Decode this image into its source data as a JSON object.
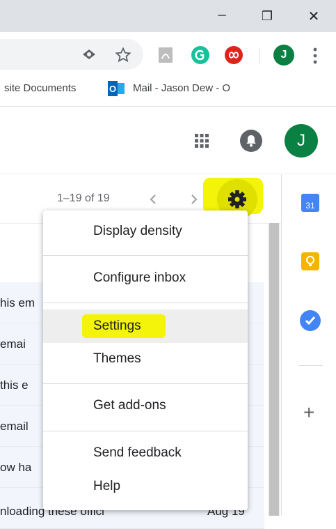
{
  "window": {
    "minimize_glyph": "─",
    "restore_glyph": "❐",
    "close_glyph": "✕"
  },
  "toolbar": {
    "avatar_letter": "J"
  },
  "bookmarks": {
    "items": [
      {
        "label": "site Documents"
      },
      {
        "label": "Mail - Jason Dew - O",
        "icon_text": "O"
      }
    ]
  },
  "header": {
    "avatar_letter": "J",
    "avatar_color": "#0b8043"
  },
  "pagination": {
    "range_text": "1–19 of 19"
  },
  "rows": [
    {
      "text": "his em"
    },
    {
      "text": " emai"
    },
    {
      "text": "this e"
    },
    {
      "text": "email"
    },
    {
      "text": "ow ha"
    },
    {
      "text": "nloading these offici",
      "extra": "Aug 19"
    }
  ],
  "side_panel": {
    "calendar_day": "31",
    "add_glyph": "+"
  },
  "menu": {
    "items": [
      {
        "label": "Display density"
      },
      {
        "label": "Configure inbox"
      },
      {
        "label": "Settings"
      },
      {
        "label": "Themes"
      },
      {
        "label": "Get add-ons"
      },
      {
        "label": "Send feedback"
      },
      {
        "label": "Help"
      }
    ]
  }
}
